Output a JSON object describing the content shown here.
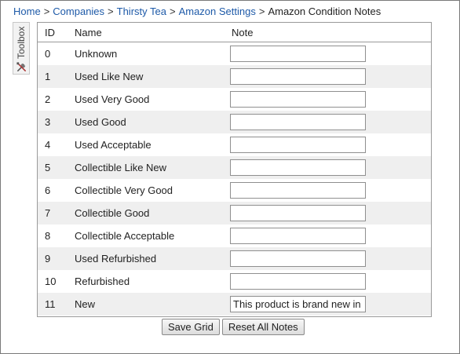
{
  "breadcrumb": {
    "items": [
      {
        "label": "Home"
      },
      {
        "label": "Companies"
      },
      {
        "label": "Thirsty Tea"
      },
      {
        "label": "Amazon Settings"
      }
    ],
    "separator": ">",
    "current": "Amazon Condition Notes"
  },
  "toolbox": {
    "label": "Toolbox",
    "icon": "tools-icon"
  },
  "grid": {
    "columns": [
      "ID",
      "Name",
      "Note"
    ],
    "rows": [
      {
        "id": "0",
        "name": "Unknown",
        "note": ""
      },
      {
        "id": "1",
        "name": "Used Like New",
        "note": ""
      },
      {
        "id": "2",
        "name": "Used Very Good",
        "note": ""
      },
      {
        "id": "3",
        "name": "Used Good",
        "note": ""
      },
      {
        "id": "4",
        "name": "Used Acceptable",
        "note": ""
      },
      {
        "id": "5",
        "name": "Collectible Like New",
        "note": ""
      },
      {
        "id": "6",
        "name": "Collectible Very Good",
        "note": ""
      },
      {
        "id": "7",
        "name": "Collectible Good",
        "note": ""
      },
      {
        "id": "8",
        "name": "Collectible Acceptable",
        "note": ""
      },
      {
        "id": "9",
        "name": "Used Refurbished",
        "note": ""
      },
      {
        "id": "10",
        "name": "Refurbished",
        "note": ""
      },
      {
        "id": "11",
        "name": "New",
        "note": "This product is brand new in"
      }
    ]
  },
  "actions": {
    "save_label": "Save Grid",
    "reset_label": "Reset All Notes"
  },
  "colors": {
    "link": "#1e5aa8",
    "row_alt": "#efefef",
    "border": "#9a9a9a"
  }
}
